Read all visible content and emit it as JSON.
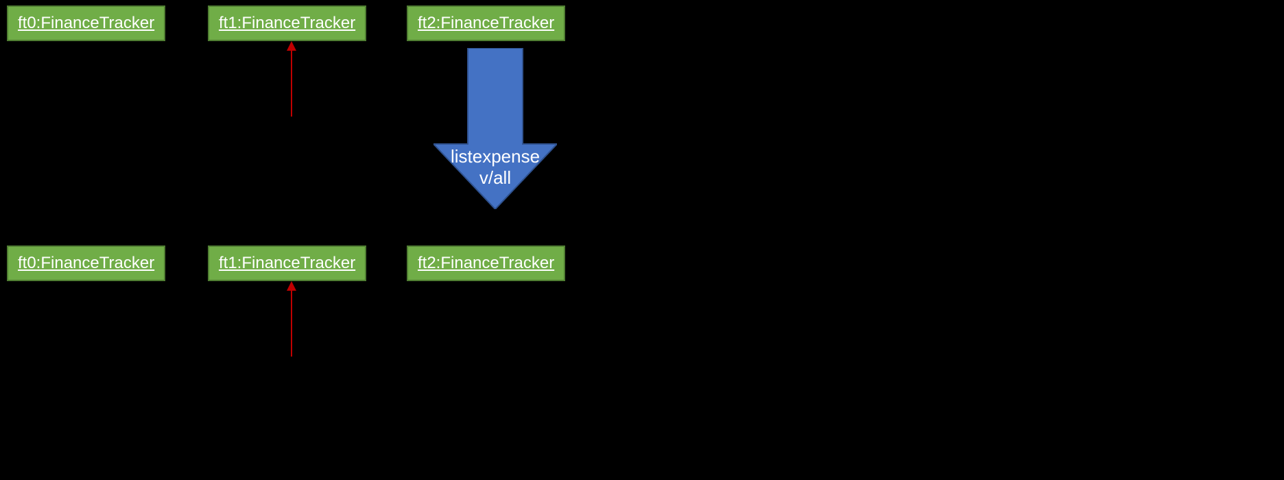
{
  "topRow": {
    "ft0": "ft0:FinanceTracker",
    "ft1": "ft1:FinanceTracker",
    "ft2": "ft2:FinanceTracker"
  },
  "bottomRow": {
    "ft0": "ft0:FinanceTracker",
    "ft1": "ft1:FinanceTracker",
    "ft2": "ft2:FinanceTracker"
  },
  "arrowLabel": {
    "line1": "listexpense",
    "line2": "v/all"
  },
  "colors": {
    "boxFill": "#70AD47",
    "boxBorder": "#507E32",
    "redArrow": "#C00000",
    "blockArrow": "#4472C4"
  }
}
